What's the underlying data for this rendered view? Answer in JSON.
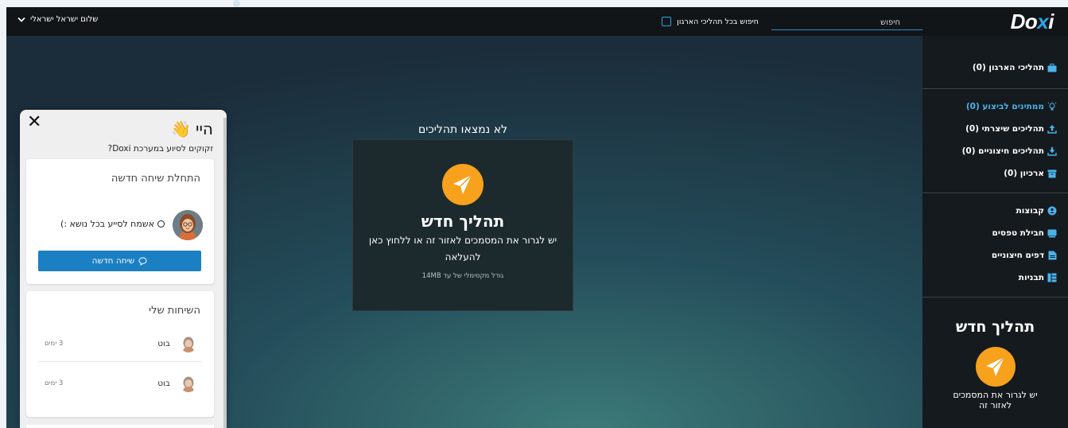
{
  "topbar": {
    "logo_main": "Do",
    "logo_accent": "x",
    "logo_end": "i",
    "search_placeholder": "חיפוש",
    "search_all_label": "חיפוש בכל תהליכי הארגון",
    "user_greeting": "שלום ישראל ישראלי"
  },
  "sidebar": {
    "group1": [
      {
        "label": "תהליכי הארגון (0)",
        "icon": "briefcase-icon",
        "color": "#49b3ec"
      }
    ],
    "group2": [
      {
        "label": "ממתינים לביצוע (0)",
        "icon": "lightbulb-icon",
        "active": true
      },
      {
        "label": "תהליכים שיצרתי (0)",
        "icon": "upload-icon"
      },
      {
        "label": "תהליכים חיצוניים (0)",
        "icon": "download-icon"
      },
      {
        "label": "ארכיון (0)",
        "icon": "archive-icon"
      }
    ],
    "group3": [
      {
        "label": "קבוצות",
        "icon": "groups-icon"
      },
      {
        "label": "חבילת טפסים",
        "icon": "forms-package-icon"
      },
      {
        "label": "דפים חיצוניים",
        "icon": "external-pages-icon"
      },
      {
        "label": "תבניות",
        "icon": "templates-icon"
      }
    ],
    "new_process_title": "תהליך חדש",
    "new_process_text": "יש לגרור את המסמכים לאזור זה"
  },
  "main": {
    "empty_message": "לא נמצאו תהליכים",
    "drop_title": "תהליך חדש",
    "drop_text": "יש לגרור את המסמכים לאזור זה או ללחוץ כאן להעלאה",
    "drop_size": "גודל מקסימלי של עד 14MB"
  },
  "chat": {
    "greeting": "היי",
    "wave_emoji": "👋",
    "subtitle": "זקוקים לסיוע במערכת Doxi?",
    "new_conv_title": "התחלת שיחה חדשה",
    "agent_text": "אשמח לסייע בכל נושא :)",
    "new_chat_button": "שיחה חדשה",
    "my_convs_title": "השיחות שלי",
    "conversations": [
      {
        "name": "בוט",
        "time": "3 ימים"
      },
      {
        "name": "בוט",
        "time": "3 ימים"
      }
    ]
  },
  "colors": {
    "accent_blue": "#2aa6e8",
    "orange": "#f7a11d",
    "topbar": "#111518",
    "sidebar": "#151a1e"
  }
}
